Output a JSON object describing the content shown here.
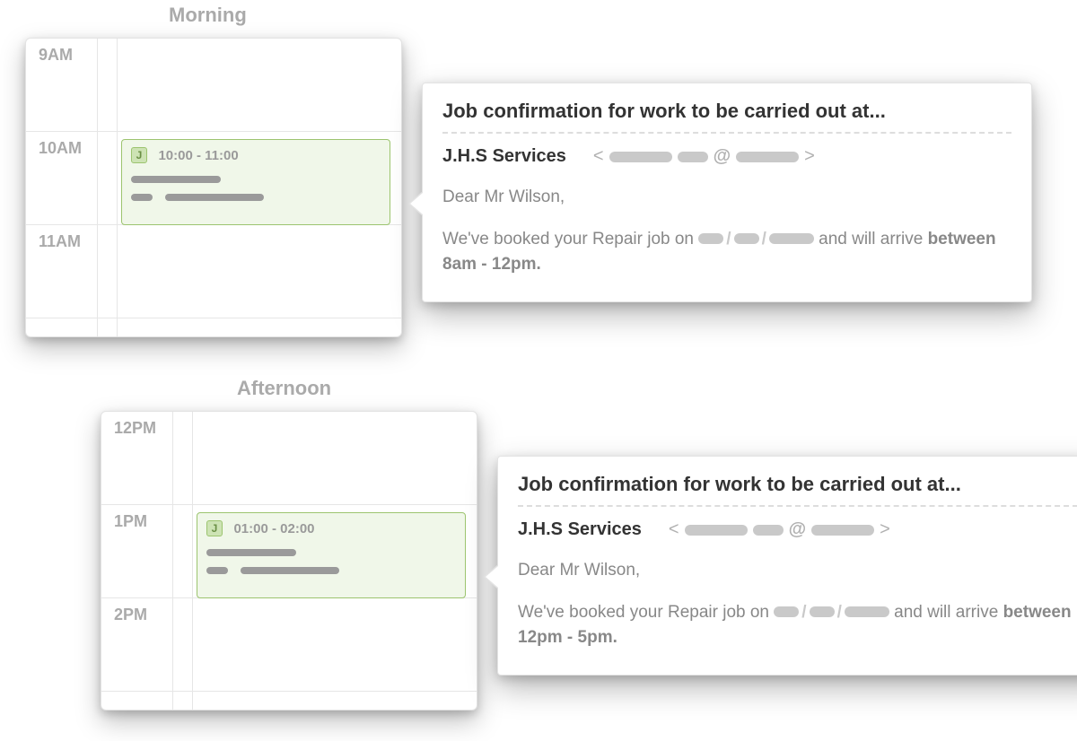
{
  "sections": [
    {
      "title": "Morning",
      "calendar": {
        "hours": [
          "9AM",
          "10AM",
          "11AM"
        ],
        "event": {
          "badge": "J",
          "time": "10:00 - 11:00"
        }
      },
      "popup": {
        "title": "Job confirmation for work to be carried out at...",
        "sender": "J.H.S Services",
        "at_symbol": "@",
        "greeting": "Dear Mr Wilson,",
        "body_prefix": "We've booked your Repair job on ",
        "body_mid": " and will arrive ",
        "arrival_window": "between 8am - 12pm."
      }
    },
    {
      "title": "Afternoon",
      "calendar": {
        "hours": [
          "12PM",
          "1PM",
          "2PM"
        ],
        "event": {
          "badge": "J",
          "time": "01:00 - 02:00"
        }
      },
      "popup": {
        "title": "Job confirmation for work to be carried out at...",
        "sender": "J.H.S Services",
        "at_symbol": "@",
        "greeting": "Dear Mr Wilson,",
        "body_prefix": "We've booked your Repair job on ",
        "body_mid": " and will arrive ",
        "arrival_window": "between 12pm - 5pm."
      }
    }
  ]
}
